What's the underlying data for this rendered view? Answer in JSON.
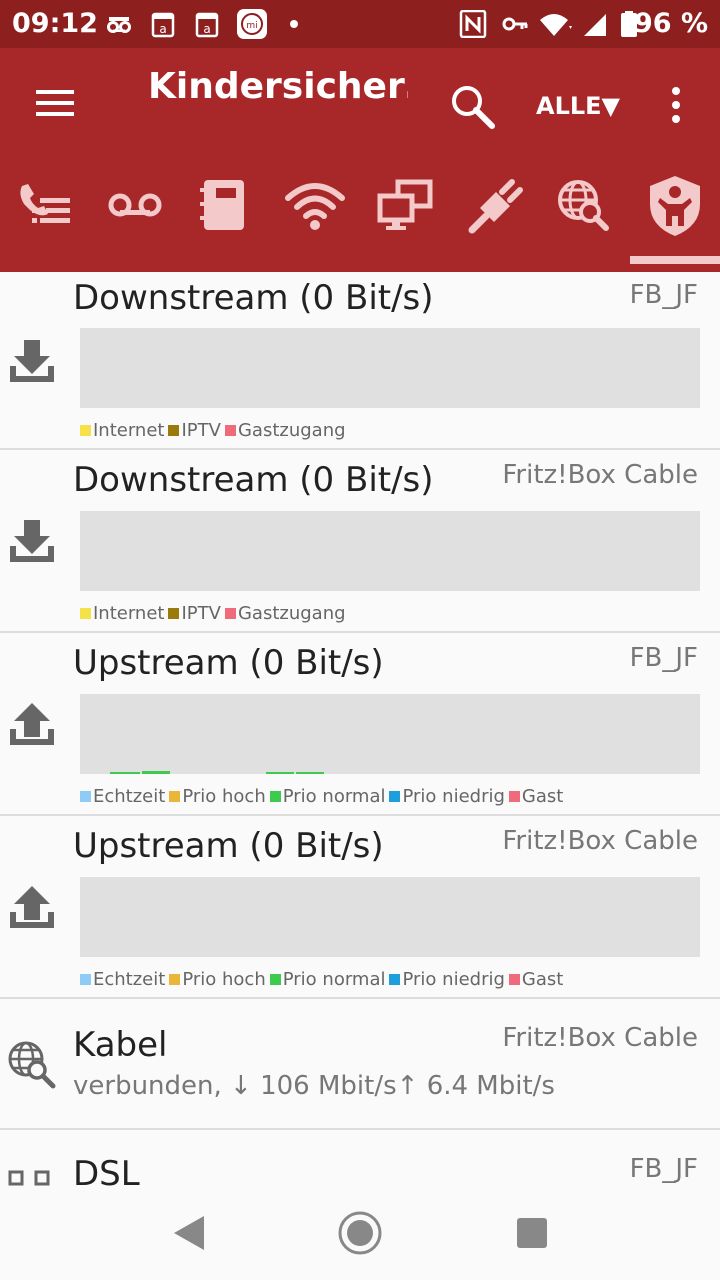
{
  "status_bar": {
    "time": "09:12",
    "battery": "96 %",
    "icons": [
      "voicemail-icon",
      "calendar-a-icon",
      "calendar-a-icon",
      "mi-icon",
      "dot-icon",
      "nfc-icon",
      "key-icon",
      "wifi-icon",
      "signal-icon",
      "battery-icon"
    ]
  },
  "app_bar": {
    "title": "Kindersicher…",
    "filter_label": "ALLE▼",
    "tabs": [
      "call-list-icon",
      "voicemail-icon",
      "phonebook-icon",
      "wifi-icon",
      "network-icon",
      "plug-icon",
      "globe-search-icon",
      "child-shield-icon"
    ]
  },
  "cards": [
    {
      "title": "Downstream (0 Bit/s)",
      "device": "FB_JF",
      "legend": [
        {
          "label": "Internet",
          "color": "#f5e14a"
        },
        {
          "label": "IPTV",
          "color": "#9a7a0c"
        },
        {
          "label": "Gastzugang",
          "color": "#ef6b7c"
        }
      ]
    },
    {
      "title": "Downstream (0 Bit/s)",
      "device": "Fritz!Box Cable",
      "legend": [
        {
          "label": "Internet",
          "color": "#f5e14a"
        },
        {
          "label": "IPTV",
          "color": "#9a7a0c"
        },
        {
          "label": "Gastzugang",
          "color": "#ef6b7c"
        }
      ]
    },
    {
      "title": "Upstream (0 Bit/s)",
      "device": "FB_JF",
      "legend": [
        {
          "label": "Echtzeit",
          "color": "#8ecbf5"
        },
        {
          "label": "Prio hoch",
          "color": "#e8b73a"
        },
        {
          "label": "Prio normal",
          "color": "#3ec94f"
        },
        {
          "label": "Prio niedrig",
          "color": "#1e9fdc"
        },
        {
          "label": "Gast",
          "color": "#ef6b7c"
        }
      ]
    },
    {
      "title": "Upstream (0 Bit/s)",
      "device": "Fritz!Box Cable",
      "legend": [
        {
          "label": "Echtzeit",
          "color": "#8ecbf5"
        },
        {
          "label": "Prio hoch",
          "color": "#e8b73a"
        },
        {
          "label": "Prio normal",
          "color": "#3ec94f"
        },
        {
          "label": "Prio niedrig",
          "color": "#1e9fdc"
        },
        {
          "label": "Gast",
          "color": "#ef6b7c"
        }
      ]
    },
    {
      "title": "Kabel",
      "device": "Fritz!Box Cable",
      "subtitle": "verbunden,  ↓ 106 Mbit/s↑ 6.4 Mbit/s"
    },
    {
      "title": "DSL",
      "device": "FB_JF"
    }
  ],
  "nav_bar": {
    "back": "back-icon",
    "home": "home-icon",
    "recents": "recents-icon"
  }
}
